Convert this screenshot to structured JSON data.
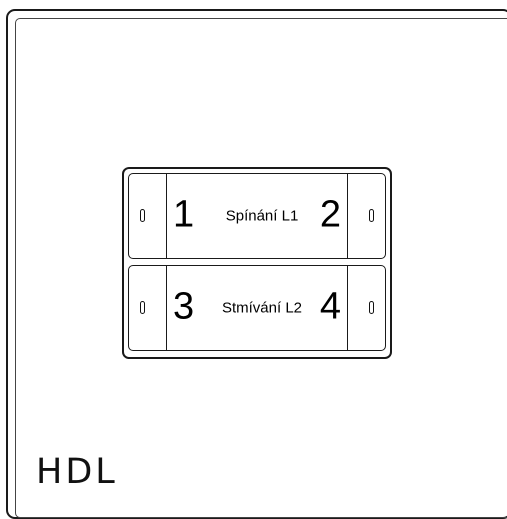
{
  "brand": "HDL",
  "buttons": [
    {
      "left_number": "1",
      "label": "Spínání L1",
      "right_number": "2"
    },
    {
      "left_number": "3",
      "label": "Stmívání L2",
      "right_number": "4"
    }
  ],
  "icons": {
    "indicator": "led-indicator-icon"
  }
}
